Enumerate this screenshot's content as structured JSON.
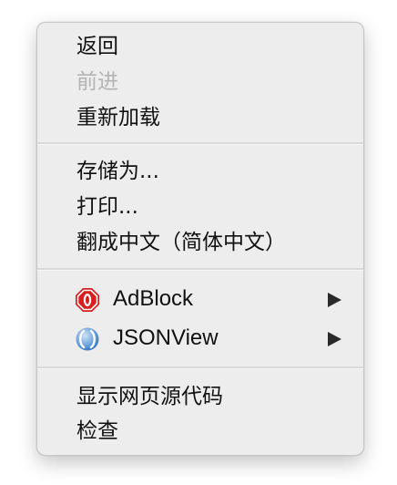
{
  "menu": {
    "group1": {
      "back": "返回",
      "forward": "前进",
      "reload": "重新加载"
    },
    "group2": {
      "save_as": "存储为...",
      "print": "打印...",
      "translate": "翻成中文（简体中文）"
    },
    "group3": {
      "adblock": {
        "label": "AdBlock",
        "icon": "adblock-icon",
        "color": "#d81e1e"
      },
      "jsonview": {
        "label": "JSONView",
        "icon": "jsonview-icon",
        "color": "#2f73c6"
      }
    },
    "group4": {
      "view_source": "显示网页源代码",
      "inspect": "检查"
    }
  }
}
